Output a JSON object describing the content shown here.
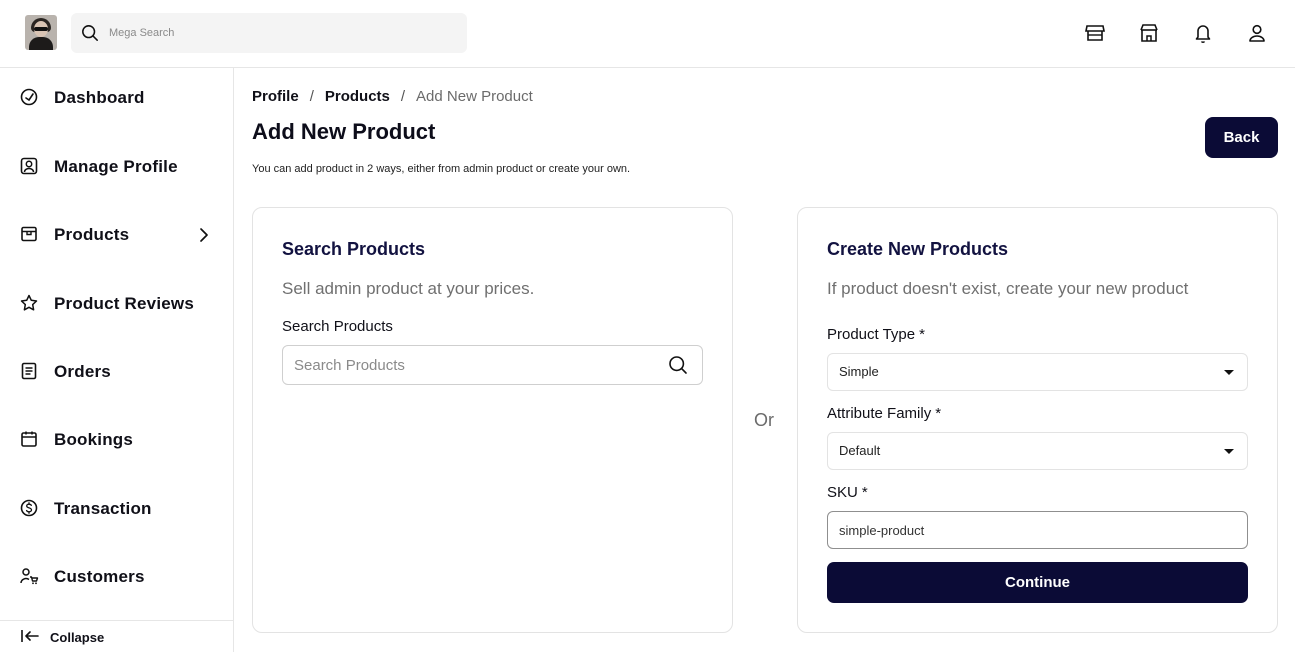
{
  "header": {
    "search_placeholder": "Mega Search"
  },
  "sidebar": {
    "items": [
      {
        "label": "Dashboard",
        "icon": "dashboard-gauge-icon"
      },
      {
        "label": "Manage Profile",
        "icon": "profile-card-icon"
      },
      {
        "label": "Products",
        "icon": "store-product-icon"
      },
      {
        "label": "Product Reviews",
        "icon": "star-icon"
      },
      {
        "label": "Orders",
        "icon": "orders-list-icon"
      },
      {
        "label": "Bookings",
        "icon": "calendar-icon"
      },
      {
        "label": "Transaction",
        "icon": "dollar-circle-icon"
      },
      {
        "label": "Customers",
        "icon": "customers-cart-icon"
      }
    ],
    "collapse_label": "Collapse"
  },
  "breadcrumb": {
    "items": [
      "Profile",
      "Products",
      "Add New Product"
    ],
    "separator": "/"
  },
  "page": {
    "title": "Add New Product",
    "subtitle": "You can add product in 2 ways, either from admin product or create your own.",
    "back_label": "Back"
  },
  "search_card": {
    "title": "Search Products",
    "subtitle": "Sell admin product at your prices.",
    "field_label": "Search Products",
    "placeholder": "Search Products"
  },
  "or_label": "Or",
  "create_card": {
    "title": "Create New Products",
    "subtitle": "If product doesn't exist, create your new product",
    "product_type_label": "Product Type",
    "product_type_value": "Simple",
    "attribute_family_label": "Attribute Family",
    "attribute_family_value": "Default",
    "sku_label": "SKU",
    "sku_value": "simple-product",
    "required_mark": "*",
    "continue_label": "Continue"
  },
  "colors": {
    "primary": "#0b0b36",
    "card_title": "#121240",
    "muted": "#707070"
  }
}
